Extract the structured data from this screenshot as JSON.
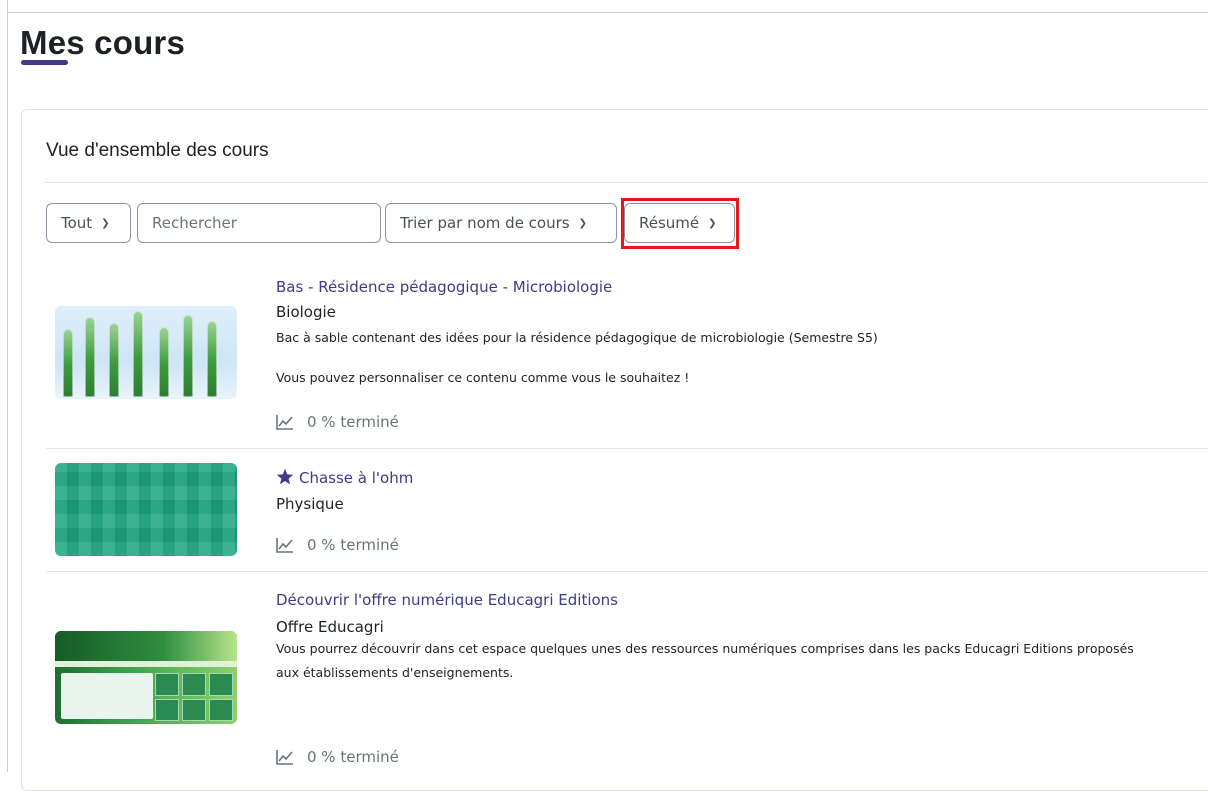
{
  "page": {
    "title": "Mes cours"
  },
  "overview": {
    "title": "Vue d'ensemble des cours",
    "filters": {
      "grouping": "Tout",
      "search_placeholder": "Rechercher",
      "sort": "Trier par nom de cours",
      "view": "Résumé"
    }
  },
  "courses": [
    {
      "name": "Bas - Résidence pédagogique - Microbiologie",
      "category": "Biologie",
      "summary_lines": [
        "Bac à sable contenant des idées pour la résidence pédagogique de microbiologie (Semestre S5)",
        "Vous pouvez personnaliser ce contenu comme vous le souhaitez !"
      ],
      "progress": "0 % terminé",
      "starred": false
    },
    {
      "name": "Chasse à l'ohm",
      "category": "Physique",
      "progress": "0 % terminé",
      "starred": true
    },
    {
      "name": "Découvrir l'offre numérique Educagri Editions",
      "category": "Offre Educagri",
      "summary_lines": [
        "Vous pourrez découvrir dans cet espace quelques unes des ressources numériques comprises dans les packs Educagri Editions proposés",
        "aux établissements d'enseignements."
      ],
      "progress": "0 % terminé",
      "starred": false
    }
  ],
  "colors": {
    "accent": "#3f3a8a",
    "highlight": "#e8161b",
    "text": "#1d2125",
    "muted": "#6a737b"
  }
}
